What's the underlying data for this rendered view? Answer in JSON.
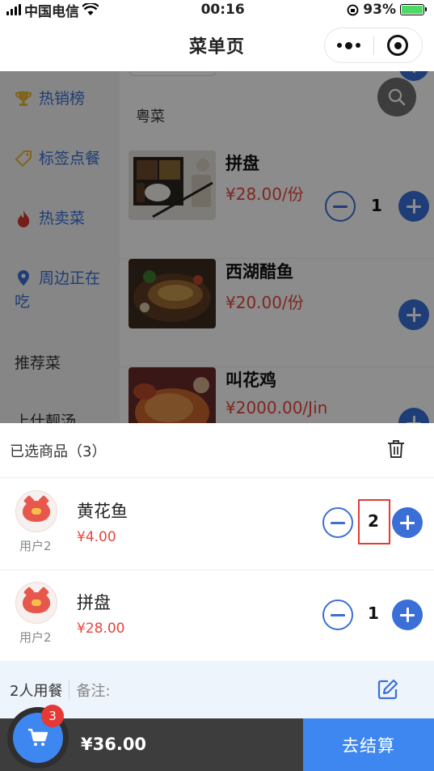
{
  "status_bar": {
    "carrier": "中国电信",
    "time": "00:16",
    "battery": "93%"
  },
  "nav": {
    "title": "菜单页"
  },
  "sidebar": {
    "items": [
      {
        "label": "热销榜",
        "icon": "trophy-icon"
      },
      {
        "label": "标签点餐",
        "icon": "tag-icon"
      },
      {
        "label": "热卖菜",
        "icon": "fire-icon"
      },
      {
        "label": "周边正在吃",
        "icon": "location-pin-icon"
      },
      {
        "label": "推荐菜"
      },
      {
        "label": "上什靓汤"
      }
    ]
  },
  "menu": {
    "category": "粤菜",
    "dishes": [
      {
        "name": "拼盘",
        "price": "¥28.00/份",
        "quantity": "1"
      },
      {
        "name": "西湖醋鱼",
        "price": "¥20.00/份"
      },
      {
        "name": "叫花鸡",
        "price": "¥2000.00/Jin"
      }
    ]
  },
  "cart": {
    "header_title": "已选商品（3）",
    "items": [
      {
        "user": "用户2",
        "name": "黄花鱼",
        "price": "¥4.00",
        "quantity": "2"
      },
      {
        "user": "用户2",
        "name": "拼盘",
        "price": "¥28.00",
        "quantity": "1"
      }
    ],
    "people": "2人用餐",
    "remark_label": "备注:",
    "badge_count": "3",
    "total": "¥36.00",
    "checkout_label": "去结算"
  },
  "colors": {
    "accent": "#3a6fd8",
    "checkout": "#3e86f0",
    "price": "#e8453c",
    "badge": "#e53935",
    "bottom_bar": "#3d3d3d"
  }
}
